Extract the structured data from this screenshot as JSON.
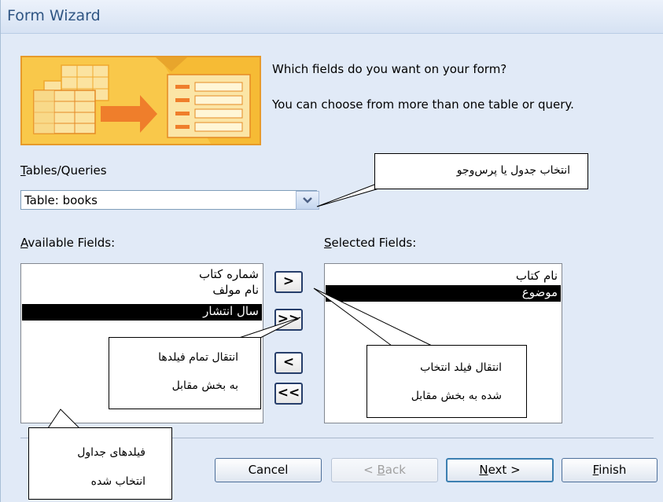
{
  "window": {
    "title": "Form Wizard"
  },
  "wizard": {
    "question": "Which fields do you want on your form?",
    "hint": "You can choose from more than one table or query."
  },
  "tables": {
    "label_u": "T",
    "label_rest": "ables/Queries",
    "selected": "Table: books"
  },
  "available": {
    "label_u": "A",
    "label_rest": "vailable Fields:",
    "items": [
      "شماره کتاب",
      "نام مولف",
      "سال انتشار"
    ],
    "selected_index": 2
  },
  "selected_fields": {
    "label_u": "S",
    "label_rest": "elected Fields:",
    "items": [
      "نام کتاب",
      "موضوع"
    ],
    "selected_index": 1
  },
  "move_buttons": {
    "add_one": ">",
    "add_all": ">>",
    "remove_one": "<",
    "remove_all": "<<"
  },
  "buttons": {
    "cancel": "Cancel",
    "back_pre": "< ",
    "back_u": "B",
    "back_rest": "ack",
    "next_u": "N",
    "next_rest": "ext >",
    "finish_u": "F",
    "finish_rest": "inish"
  },
  "callouts": {
    "table_select": "انتخاب جدول یا پرس‌وجو",
    "move_all_line1": "انتقال تمام فیلدها",
    "move_all_line2": "به بخش مقابل",
    "move_selected_line1": "انتقال فیلد انتخاب",
    "move_selected_line2": "شده به بخش مقابل",
    "fields_line1": "فیلدهای جداول",
    "fields_line2": "انتخاب شده"
  },
  "colors": {
    "title_text": "#2f5583",
    "dialog_bg": "#e1eaf7",
    "illustration_orange": "#f8c43e",
    "selection": "#000000"
  },
  "icons": {
    "combo_arrow": "chevron-down-icon",
    "illustration": "wizard-illustration-icon"
  }
}
